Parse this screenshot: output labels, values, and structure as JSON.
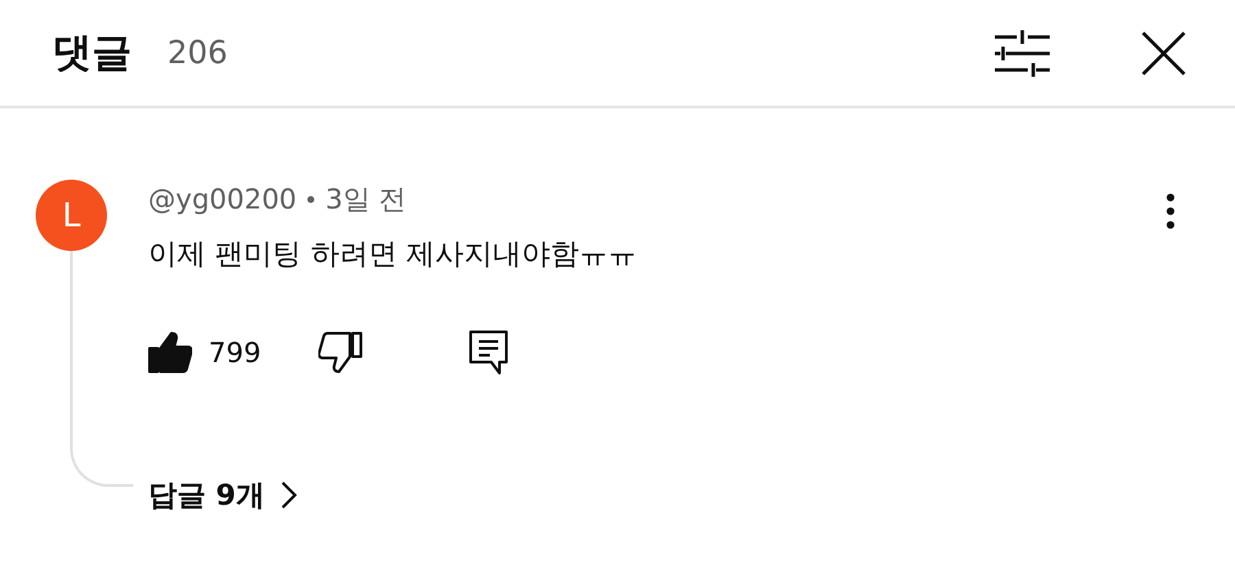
{
  "header": {
    "title": "댓글",
    "count": "206"
  },
  "comment": {
    "avatar_letter": "L",
    "author": "@yg00200",
    "time": "3일 전",
    "text": "이제 팬미팅 하려면 제사지내야함ㅠㅠ",
    "likes": "799",
    "liked": true,
    "disliked": false,
    "replies": "답글 9개"
  }
}
